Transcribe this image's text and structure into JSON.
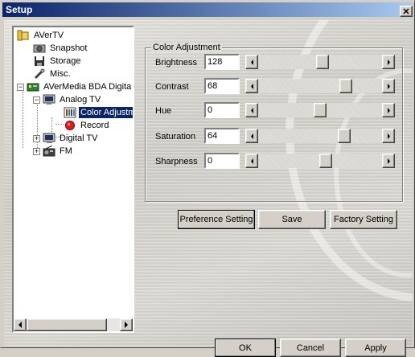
{
  "window": {
    "title": "Setup",
    "close_label": "✕"
  },
  "tree": {
    "items": [
      {
        "id": "avertv",
        "label": "AVerTV",
        "icon": "folder-icon"
      },
      {
        "id": "snapshot",
        "label": "Snapshot",
        "icon": "camera-icon"
      },
      {
        "id": "storage",
        "label": "Storage",
        "icon": "floppy-icon"
      },
      {
        "id": "misc",
        "label": "Misc.",
        "icon": "wrench-icon"
      },
      {
        "id": "avermedia",
        "label": "AVerMedia BDA Digita",
        "icon": "device-icon"
      },
      {
        "id": "analogtv",
        "label": "Analog TV",
        "icon": "tv-icon"
      },
      {
        "id": "coloradjust",
        "label": "Color Adjustm",
        "icon": "color-bars-icon"
      },
      {
        "id": "record",
        "label": "Record",
        "icon": "record-icon"
      },
      {
        "id": "digitaltv",
        "label": "Digital TV",
        "icon": "tv-icon"
      },
      {
        "id": "fm",
        "label": "FM",
        "icon": "radio-icon"
      }
    ],
    "selected": "Color Adjustm"
  },
  "color_adjustment": {
    "group_title": "Color Adjustment",
    "rows": [
      {
        "label": "Brightness",
        "value": "128",
        "level": 0.52
      },
      {
        "label": "Contrast",
        "value": "68",
        "level": 0.73
      },
      {
        "label": "Hue",
        "value": "0",
        "level": 0.5
      },
      {
        "label": "Saturation",
        "value": "64",
        "level": 0.72
      },
      {
        "label": "Sharpness",
        "value": "0",
        "level": 0.55
      }
    ]
  },
  "buttons": {
    "preference": "Preference Setting",
    "save": "Save",
    "factory": "Factory Setting",
    "ok": "OK",
    "cancel": "Cancel",
    "apply": "Apply"
  },
  "colors": {
    "title_bar": "#0a246a",
    "selection": "#0a246a",
    "face": "#d4d0c8"
  }
}
